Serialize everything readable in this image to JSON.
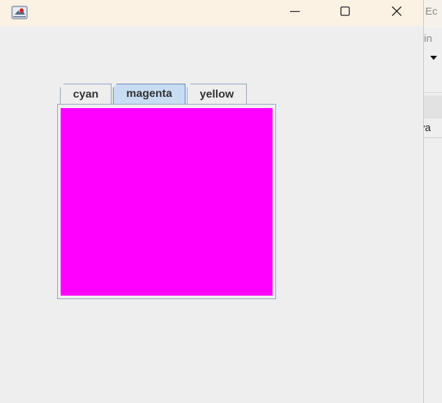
{
  "background_app": {
    "text_top": "Ec",
    "text_middle": "/in",
    "text_lower": "va"
  },
  "window": {
    "title": "",
    "controls": {
      "minimize": "minimize",
      "maximize": "maximize",
      "close": "close"
    }
  },
  "tabs": [
    {
      "label": "cyan",
      "selected": false,
      "color": "#00ffff"
    },
    {
      "label": "magenta",
      "selected": true,
      "color": "#ff00ff"
    },
    {
      "label": "yellow",
      "selected": false,
      "color": "#ffff00"
    }
  ],
  "active_panel": {
    "color": "#ff00ff"
  },
  "colors": {
    "titlebar": "#fbf2e4",
    "window_bg": "#eeeeee",
    "selected_tab_bg": "#c8ddf2",
    "tab_border": "#8da3c1"
  }
}
